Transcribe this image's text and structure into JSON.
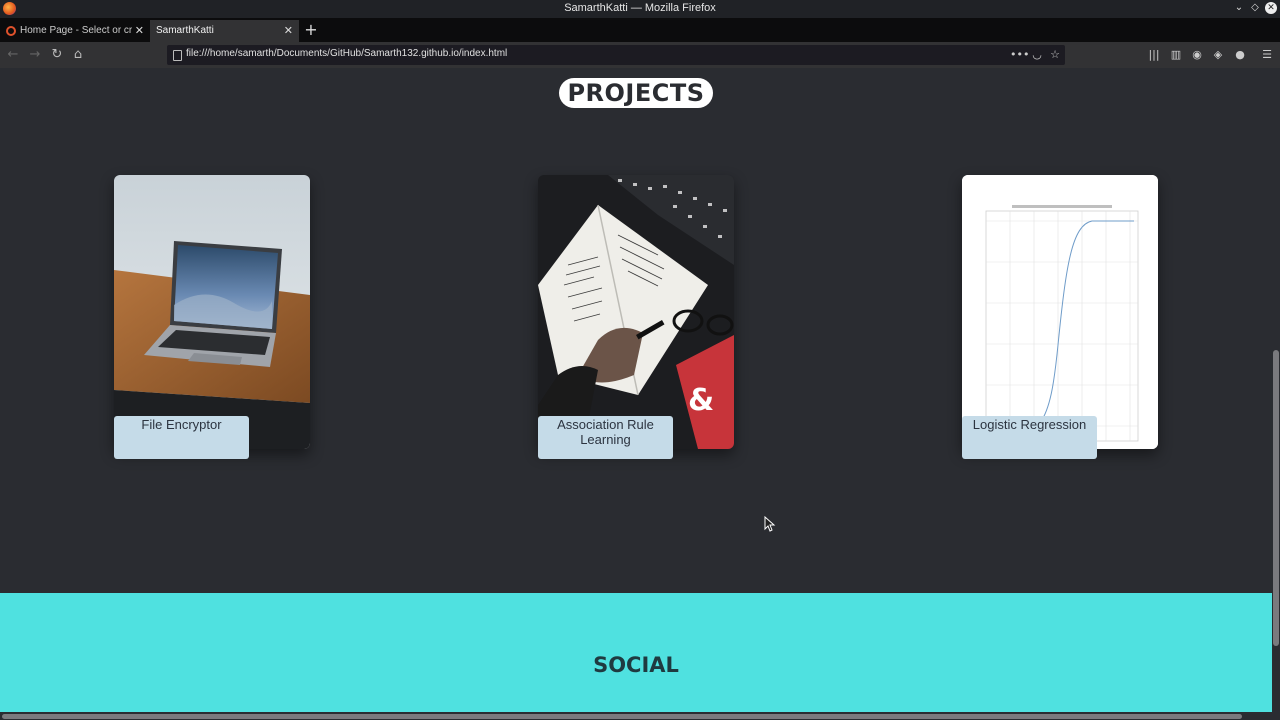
{
  "window": {
    "title": "SamarthKatti — Mozilla Firefox"
  },
  "tabs": [
    {
      "label": "Home Page - Select or cre",
      "active": false
    },
    {
      "label": "SamarthKatti",
      "active": true
    }
  ],
  "navbar": {
    "url": "file:///home/samarth/Documents/GitHub/Samarth132.github.io/index.html"
  },
  "page": {
    "projects_title": "PROJECTS",
    "projects": [
      {
        "label": "File Encryptor",
        "image": "laptop-on-table"
      },
      {
        "label": "Association Rule Learning",
        "image": "notebook-and-glasses"
      },
      {
        "label": "Logistic Regression",
        "image": "sigmoid-graph"
      }
    ],
    "social_title": "SOCIAL"
  },
  "colors": {
    "page_bg": "#2a2c31",
    "social_bg": "#4fe1e0",
    "label_bg": "#c5dbe8"
  }
}
